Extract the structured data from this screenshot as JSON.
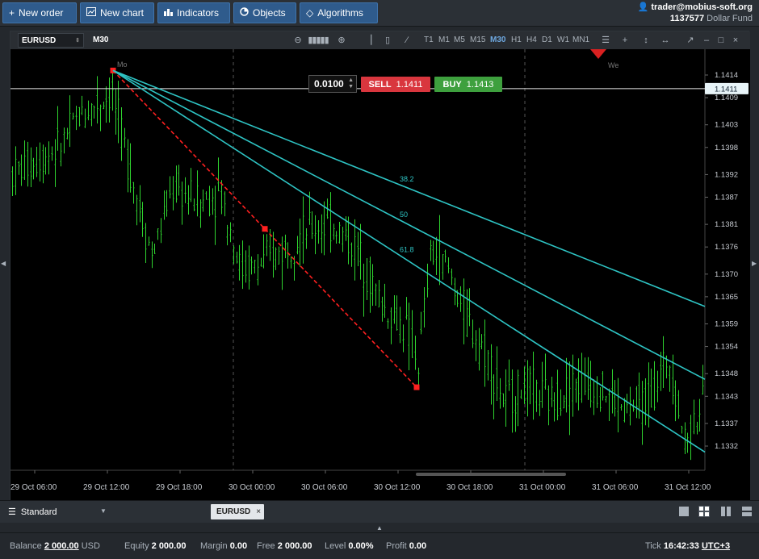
{
  "toolbar": {
    "new_order": "New order",
    "new_chart": "New chart",
    "indicators": "Indicators",
    "objects": "Objects",
    "algorithms": "Algorithms"
  },
  "account": {
    "user": "trader@mobius-soft.org",
    "number": "1137577",
    "fund": "Dollar Fund"
  },
  "chart_window": {
    "symbol": "EURUSD",
    "timeframe": "M30",
    "timeframes": [
      "T1",
      "M1",
      "M5",
      "M15",
      "M30",
      "H1",
      "H4",
      "D1",
      "W1",
      "MN1"
    ],
    "active_timeframe": "M30"
  },
  "order_panel": {
    "lot": "0.0100",
    "sell_label": "SELL",
    "sell_price": "1.1411",
    "buy_label": "BUY",
    "buy_price": "1.1413"
  },
  "chart_data": {
    "type": "candlestick",
    "price_scale": [
      "1.1414",
      "1.1409",
      "1.1403",
      "1.1398",
      "1.1392",
      "1.1387",
      "1.1381",
      "1.1376",
      "1.1370",
      "1.1365",
      "1.1359",
      "1.1354",
      "1.1348",
      "1.1343",
      "1.1337",
      "1.1332"
    ],
    "current_price_label": "1.1411",
    "current_price": 1.1411,
    "time_labels": [
      "29 Oct 06:00",
      "29 Oct 12:00",
      "29 Oct 18:00",
      "30 Oct 00:00",
      "30 Oct 06:00",
      "30 Oct 12:00",
      "30 Oct 18:00",
      "31 Oct 00:00",
      "31 Oct 06:00",
      "31 Oct 12:00"
    ],
    "session_labels": [
      "Mo",
      "We"
    ],
    "fan_levels": [
      "61.8",
      "50",
      "38.2"
    ],
    "fan_anchor": {
      "time": "29 Oct 12:30",
      "price": 1.1415
    },
    "fan_end": {
      "time": "30 Oct 12:30",
      "price": 1.1345
    },
    "bull_color": "#2fd42f",
    "bear_color": "#2fd42f",
    "fan_color": "#2ec4c4",
    "trend_color": "#ff2020"
  },
  "bottom": {
    "workspace": "Standard",
    "tab": "EURUSD"
  },
  "status": {
    "balance_label": "Balance",
    "balance": "2 000.00",
    "balance_ccy": "USD",
    "equity_label": "Equity",
    "equity": "2 000.00",
    "margin_label": "Margin",
    "margin": "0.00",
    "free_label": "Free",
    "free": "2 000.00",
    "level_label": "Level",
    "level": "0.00%",
    "profit_label": "Profit",
    "profit": "0.00",
    "tick_label": "Tick",
    "tick": "16:42:33",
    "tz": "UTC+3"
  }
}
